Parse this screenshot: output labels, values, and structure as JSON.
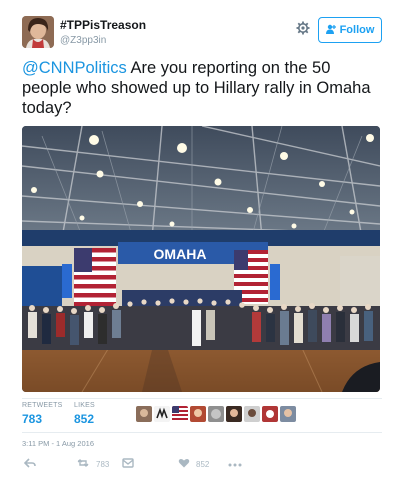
{
  "user": {
    "display_name": "#TPPisTreason",
    "handle": "@Z3pp3in",
    "follow_label": "Follow"
  },
  "tweet": {
    "mention": "@CNNPolitics",
    "text": " Are you reporting on the 50 people who showed up to Hillary rally in Omaha today?"
  },
  "photo": {
    "banner_text": "OMAHA"
  },
  "stats": {
    "retweets_label": "RETWEETS",
    "retweets_value": "783",
    "likes_label": "LIKES",
    "likes_value": "852"
  },
  "timestamp": "3:11 PM - 1 Aug 2016",
  "actions": {
    "retweet_count": "783",
    "like_count": "852"
  },
  "icons": {
    "gear": "gear-icon",
    "follow": "add-user-icon",
    "reply": "reply-icon",
    "retweet": "retweet-icon",
    "like": "heart-icon",
    "more": "more-icon"
  },
  "colors": {
    "accent": "#1da1f2",
    "link": "#1b95e0",
    "muted": "#8899a6"
  }
}
